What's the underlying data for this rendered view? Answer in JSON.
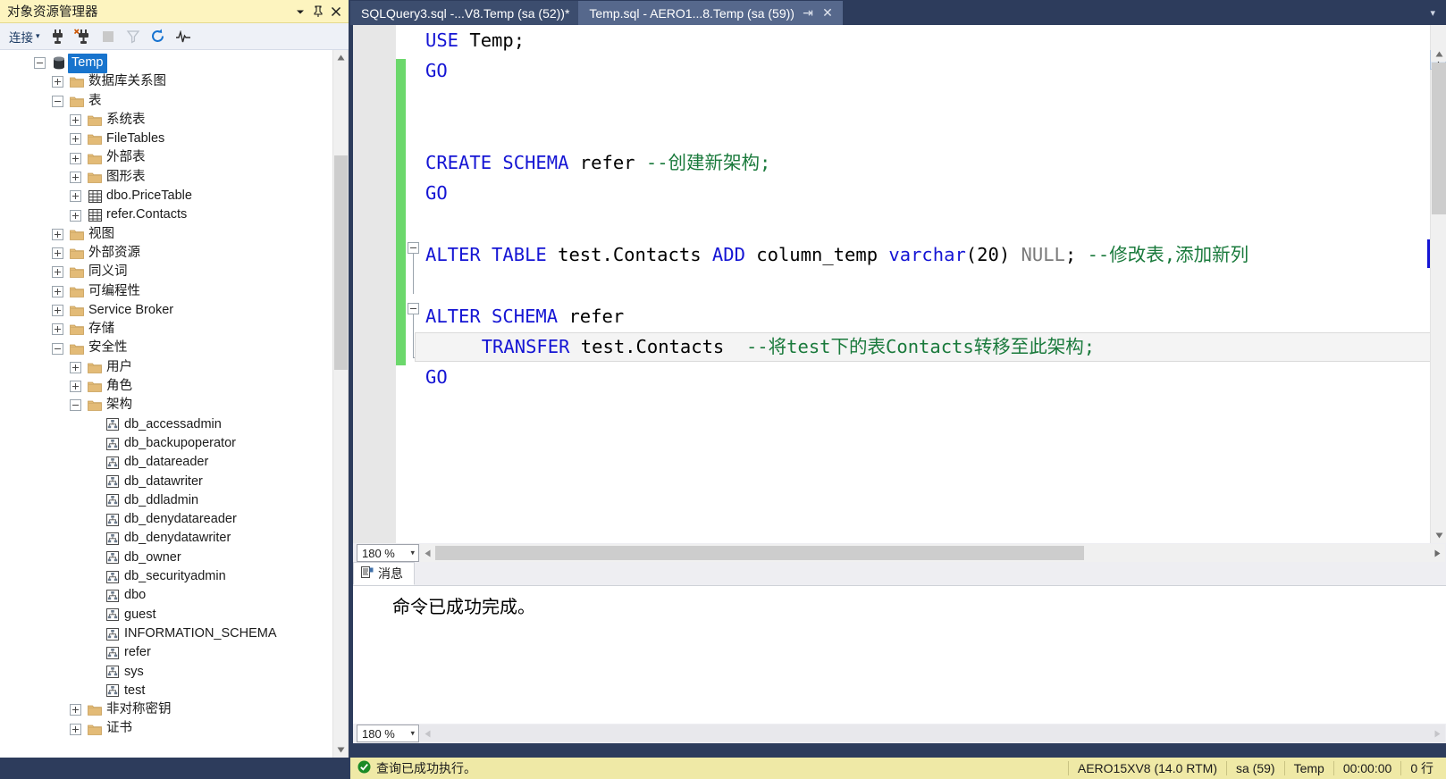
{
  "explorer": {
    "title": "对象资源管理器",
    "titlebar_buttons": [
      {
        "name": "dropdown",
        "glyph": "▾"
      },
      {
        "name": "pin",
        "glyph": "pin"
      },
      {
        "name": "close",
        "glyph": "✕"
      }
    ],
    "toolbar": {
      "connect_label": "连接",
      "connect_caret": "▾",
      "icons": [
        "connect-icon",
        "disconnect-icon",
        "stop-icon",
        "filter-icon",
        "refresh-icon",
        "activity-monitor-icon"
      ]
    },
    "tree": [
      {
        "label": "Temp",
        "indent": 0,
        "twisty": "minus",
        "icon": "database-icon",
        "selected": true
      },
      {
        "label": "数据库关系图",
        "indent": 1,
        "twisty": "plus",
        "icon": "folder-icon",
        "selected": false
      },
      {
        "label": "表",
        "indent": 1,
        "twisty": "minus",
        "icon": "folder-icon",
        "selected": false
      },
      {
        "label": "系统表",
        "indent": 2,
        "twisty": "plus",
        "icon": "folder-icon",
        "selected": false
      },
      {
        "label": "FileTables",
        "indent": 2,
        "twisty": "plus",
        "icon": "folder-icon",
        "selected": false
      },
      {
        "label": "外部表",
        "indent": 2,
        "twisty": "plus",
        "icon": "folder-icon",
        "selected": false
      },
      {
        "label": "图形表",
        "indent": 2,
        "twisty": "plus",
        "icon": "folder-icon",
        "selected": false
      },
      {
        "label": "dbo.PriceTable",
        "indent": 2,
        "twisty": "plus",
        "icon": "table-icon",
        "selected": false
      },
      {
        "label": "refer.Contacts",
        "indent": 2,
        "twisty": "plus",
        "icon": "table-icon",
        "selected": false
      },
      {
        "label": "视图",
        "indent": 1,
        "twisty": "plus",
        "icon": "folder-icon",
        "selected": false
      },
      {
        "label": "外部资源",
        "indent": 1,
        "twisty": "plus",
        "icon": "folder-icon",
        "selected": false
      },
      {
        "label": "同义词",
        "indent": 1,
        "twisty": "plus",
        "icon": "folder-icon",
        "selected": false
      },
      {
        "label": "可编程性",
        "indent": 1,
        "twisty": "plus",
        "icon": "folder-icon",
        "selected": false
      },
      {
        "label": "Service Broker",
        "indent": 1,
        "twisty": "plus",
        "icon": "folder-icon",
        "selected": false
      },
      {
        "label": "存储",
        "indent": 1,
        "twisty": "plus",
        "icon": "folder-icon",
        "selected": false
      },
      {
        "label": "安全性",
        "indent": 1,
        "twisty": "minus",
        "icon": "folder-icon",
        "selected": false
      },
      {
        "label": "用户",
        "indent": 2,
        "twisty": "plus",
        "icon": "folder-icon",
        "selected": false
      },
      {
        "label": "角色",
        "indent": 2,
        "twisty": "plus",
        "icon": "folder-icon",
        "selected": false
      },
      {
        "label": "架构",
        "indent": 2,
        "twisty": "minus",
        "icon": "folder-icon",
        "selected": false
      },
      {
        "label": "db_accessadmin",
        "indent": 3,
        "twisty": "none",
        "icon": "schema-icon",
        "selected": false
      },
      {
        "label": "db_backupoperator",
        "indent": 3,
        "twisty": "none",
        "icon": "schema-icon",
        "selected": false
      },
      {
        "label": "db_datareader",
        "indent": 3,
        "twisty": "none",
        "icon": "schema-icon",
        "selected": false
      },
      {
        "label": "db_datawriter",
        "indent": 3,
        "twisty": "none",
        "icon": "schema-icon",
        "selected": false
      },
      {
        "label": "db_ddladmin",
        "indent": 3,
        "twisty": "none",
        "icon": "schema-icon",
        "selected": false
      },
      {
        "label": "db_denydatareader",
        "indent": 3,
        "twisty": "none",
        "icon": "schema-icon",
        "selected": false
      },
      {
        "label": "db_denydatawriter",
        "indent": 3,
        "twisty": "none",
        "icon": "schema-icon",
        "selected": false
      },
      {
        "label": "db_owner",
        "indent": 3,
        "twisty": "none",
        "icon": "schema-icon",
        "selected": false
      },
      {
        "label": "db_securityadmin",
        "indent": 3,
        "twisty": "none",
        "icon": "schema-icon",
        "selected": false
      },
      {
        "label": "dbo",
        "indent": 3,
        "twisty": "none",
        "icon": "schema-icon",
        "selected": false
      },
      {
        "label": "guest",
        "indent": 3,
        "twisty": "none",
        "icon": "schema-icon",
        "selected": false
      },
      {
        "label": "INFORMATION_SCHEMA",
        "indent": 3,
        "twisty": "none",
        "icon": "schema-icon",
        "selected": false
      },
      {
        "label": "refer",
        "indent": 3,
        "twisty": "none",
        "icon": "schema-icon",
        "selected": false
      },
      {
        "label": "sys",
        "indent": 3,
        "twisty": "none",
        "icon": "schema-icon",
        "selected": false
      },
      {
        "label": "test",
        "indent": 3,
        "twisty": "none",
        "icon": "schema-icon",
        "selected": false
      },
      {
        "label": "非对称密钥",
        "indent": 2,
        "twisty": "plus",
        "icon": "folder-icon",
        "selected": false
      },
      {
        "label": "证书",
        "indent": 2,
        "twisty": "plus",
        "icon": "folder-icon",
        "selected": false
      }
    ]
  },
  "tabs": [
    {
      "label": "SQLQuery3.sql -...V8.Temp (sa (52))*",
      "active": true,
      "close_glyph": "",
      "pin_glyph": ""
    },
    {
      "label": "Temp.sql - AERO1...8.Temp (sa (59))",
      "active": false,
      "close_glyph": "✕",
      "pin_glyph": "⇥"
    }
  ],
  "tabstrip_overflow_glyph": "▾",
  "editor": {
    "lines": [
      [
        {
          "t": "USE",
          "c": "kw"
        },
        {
          "t": " Temp;",
          "c": "id"
        }
      ],
      [
        {
          "t": "GO",
          "c": "kw"
        }
      ],
      [],
      [],
      [
        {
          "t": "CREATE SCHEMA",
          "c": "kw"
        },
        {
          "t": " refer ",
          "c": "id"
        },
        {
          "t": "--创建新架构;",
          "c": "cm"
        }
      ],
      [
        {
          "t": "GO",
          "c": "kw"
        }
      ],
      [],
      [
        {
          "t": "ALTER TABLE",
          "c": "kw"
        },
        {
          "t": " test.Contacts ",
          "c": "id"
        },
        {
          "t": "ADD",
          "c": "kw"
        },
        {
          "t": " column_temp ",
          "c": "id"
        },
        {
          "t": "varchar",
          "c": "kw"
        },
        {
          "t": "(20) ",
          "c": "id"
        },
        {
          "t": "NULL",
          "c": "gray"
        },
        {
          "t": "; ",
          "c": "id"
        },
        {
          "t": "--修改表,添加新列",
          "c": "cm"
        }
      ],
      [],
      [
        {
          "t": "ALTER SCHEMA",
          "c": "kw"
        },
        {
          "t": " refer",
          "c": "id"
        }
      ],
      [
        {
          "t": "     ",
          "c": "id"
        },
        {
          "t": "TRANSFER",
          "c": "kw"
        },
        {
          "t": " test.Contacts  ",
          "c": "id"
        },
        {
          "t": "--将test下的表Contacts转移至此架构;",
          "c": "cm"
        }
      ],
      [
        {
          "t": "GO",
          "c": "kw"
        }
      ]
    ],
    "zoom_level": "180 %",
    "zoom_dropdown_glyph": "▾"
  },
  "results": {
    "tab_label": "消息",
    "tab_icon": "message-grid-icon",
    "message_text": "命令已成功完成。",
    "zoom_level": "180 %",
    "zoom_dropdown_glyph": "▾"
  },
  "statusbar": {
    "status_icon": "success-check-icon",
    "status_text": "查询已成功执行。",
    "cells": [
      "AERO15XV8 (14.0 RTM)",
      "sa (59)",
      "Temp",
      "00:00:00",
      "0 行"
    ]
  },
  "colors": {
    "accent_yellow": "#fdf4bf",
    "status_yellow": "#efe9a6",
    "selection_blue": "#1874cd",
    "chrome_navy": "#2d3c5c",
    "keyword_blue": "#1515d4",
    "comment_green": "#1a7a3c",
    "change_bar_green": "#6cd86c"
  }
}
